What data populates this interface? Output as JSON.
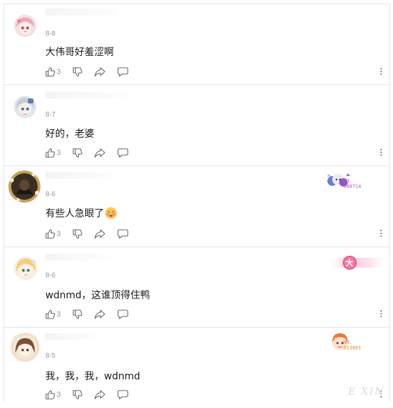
{
  "comments": [
    {
      "date": "8-8",
      "text": "大伟哥好羞涩啊",
      "likes": "3",
      "avatar": "anime-girl-pink-avatar"
    },
    {
      "date": "8-7",
      "text": "好的，老婆",
      "likes": "3",
      "avatar": "anime-girl-silver-avatar"
    },
    {
      "date": "8-6",
      "text": "有些人急眼了",
      "likes": "3",
      "avatar": "dark-character-avatar",
      "badge_no": "NO.",
      "badge_num": "000714"
    },
    {
      "date": "8-6",
      "text": "wdnmd，这谁顶得住鸭",
      "likes": "3",
      "avatar": "blonde-girl-avatar",
      "badge_char": "大"
    },
    {
      "date": "8-5",
      "text": "我，我，我，wdnmd",
      "likes": "3",
      "avatar": "brown-hair-girl-avatar",
      "badge_no": "NO.",
      "badge_num": "013881"
    }
  ],
  "watermark": "E XIN"
}
